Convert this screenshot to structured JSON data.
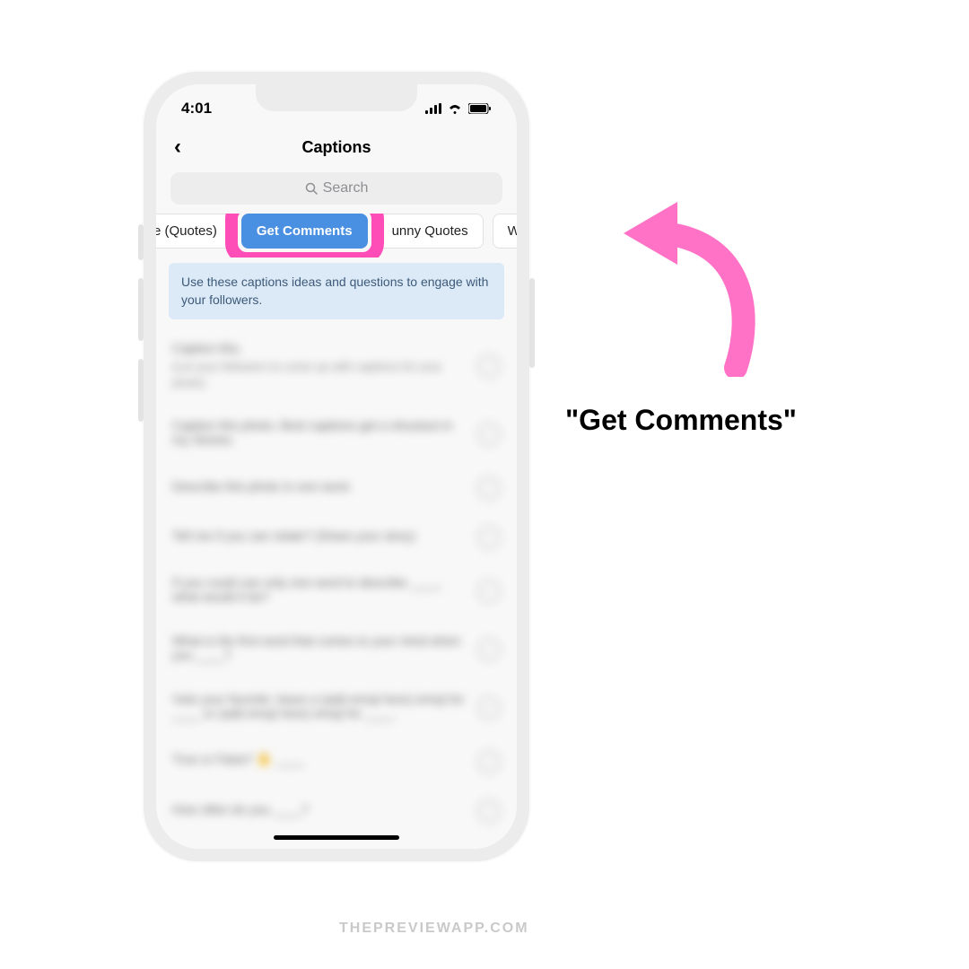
{
  "status": {
    "time": "4:01"
  },
  "nav": {
    "title": "Captions",
    "back_glyph": "‹"
  },
  "search": {
    "placeholder": "Search",
    "icon_glyph": "🔍"
  },
  "chips": {
    "partial_left": "e (Quotes)",
    "active": "Get Comments",
    "next1": "unny Quotes",
    "next2": "Weird "
  },
  "info": {
    "text": "Use these captions ideas and questions to engage with your followers."
  },
  "list": [
    {
      "title": "Caption this.",
      "sub": "(Let your followers to come up with captions for your photo)"
    },
    {
      "title": "Caption this photo. Best captions get a shoutout in my Stories.",
      "sub": ""
    },
    {
      "title": "Describe this photo in one word.",
      "sub": ""
    },
    {
      "title": "Tell me if you can relate? (Share your story)",
      "sub": ""
    },
    {
      "title": "If you could use only one word to describe ____, what would it be?",
      "sub": ""
    },
    {
      "title": "What is the first word that comes to your mind when you ____?",
      "sub": ""
    },
    {
      "title": "Vote your favorite: leave a (add emoji here) emoji for ____ or (add emoji here) emoji for ____.",
      "sub": ""
    },
    {
      "title": "True or False? ✋ ____",
      "sub": ""
    },
    {
      "title": "How often do you ____?",
      "sub": ""
    }
  ],
  "annotation": {
    "label": "\"Get Comments\""
  },
  "watermark": "THEPREVIEWAPP.COM"
}
